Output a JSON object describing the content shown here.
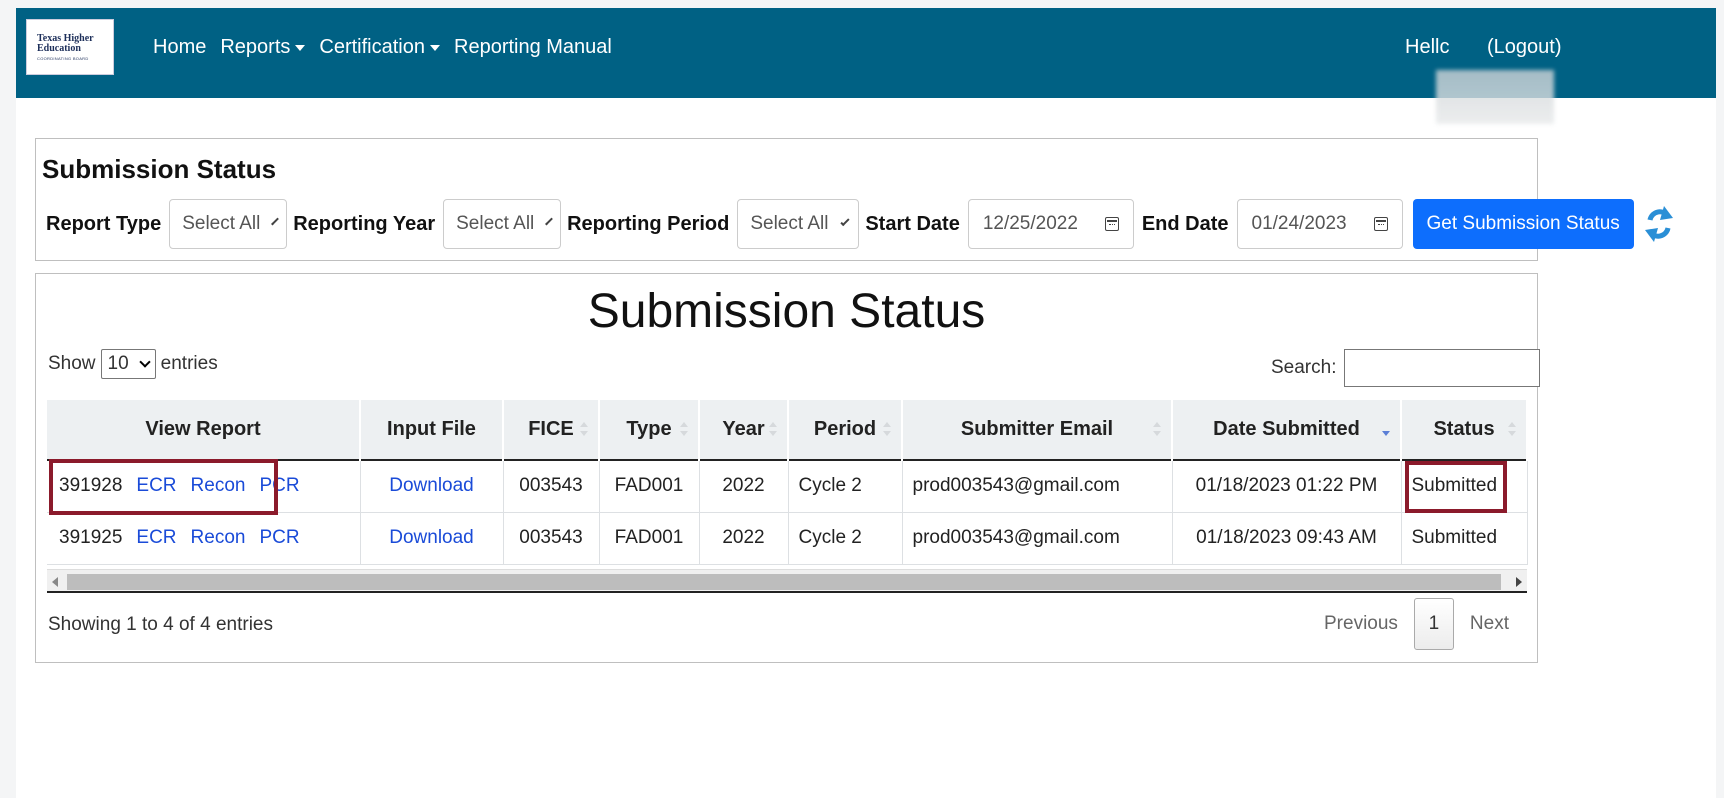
{
  "navbar": {
    "logo": {
      "line1": "Texas Higher",
      "line2": "Education",
      "line3": "COORDINATING BOARD"
    },
    "links": [
      {
        "label": "Home",
        "dropdown": false
      },
      {
        "label": "Reports",
        "dropdown": true
      },
      {
        "label": "Certification",
        "dropdown": true
      },
      {
        "label": "Reporting Manual",
        "dropdown": false
      }
    ],
    "greeting": "Hellc",
    "logout": "(Logout)"
  },
  "filters": {
    "title": "Submission Status",
    "report_type_label": "Report Type",
    "report_type_value": "Select All",
    "reporting_year_label": "Reporting Year",
    "reporting_year_value": "Select All",
    "reporting_period_label": "Reporting Period",
    "reporting_period_value": "Select All",
    "start_date_label": "Start Date",
    "start_date_value": "12/25/2022",
    "end_date_label": "End Date",
    "end_date_value": "01/24/2023",
    "submit_label": "Get Submission Status"
  },
  "table_panel": {
    "title": "Submission Status",
    "show_label": "Show",
    "length_value": "10",
    "entries_label": "entries",
    "search_label": "Search:",
    "columns": [
      "View Report",
      "Input File",
      "FICE",
      "Type",
      "Year",
      "Period",
      "Submitter Email",
      "Date Submitted",
      "Status"
    ],
    "rows": [
      {
        "id": "391928",
        "links": [
          "ECR",
          "Recon",
          "PCR"
        ],
        "input_file": "Download",
        "fice": "003543",
        "type": "FAD001",
        "year": "2022",
        "period": "Cycle 2",
        "email": "prod003543@gmail.com",
        "date": "01/18/2023 01:22 PM",
        "status": "Submitted"
      },
      {
        "id": "391925",
        "links": [
          "ECR",
          "Recon",
          "PCR"
        ],
        "input_file": "Download",
        "fice": "003543",
        "type": "FAD001",
        "year": "2022",
        "period": "Cycle 2",
        "email": "prod003543@gmail.com",
        "date": "01/18/2023 09:43 AM",
        "status": "Submitted"
      }
    ],
    "info": "Showing 1 to 4 of 4 entries",
    "pagination": {
      "previous": "Previous",
      "current": "1",
      "next": "Next"
    }
  },
  "colors": {
    "navbar": "#006184",
    "primary_button": "#0d6efd",
    "link": "#1a4bd8",
    "highlight": "#8b1a2b"
  }
}
